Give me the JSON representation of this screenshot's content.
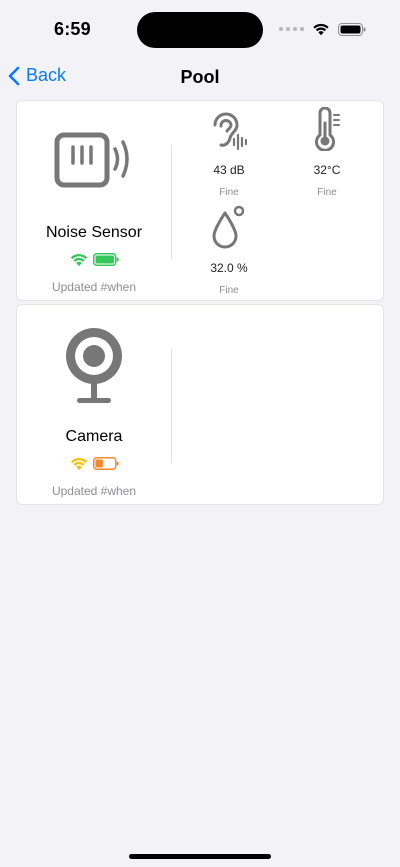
{
  "status_bar": {
    "time": "6:59"
  },
  "nav": {
    "back_label": "Back",
    "title": "Pool"
  },
  "devices": [
    {
      "name": "Noise Sensor",
      "icon": "noise-sensor-icon",
      "wifi_color": "#34c759",
      "battery_color": "#34c759",
      "battery_level": 1.0,
      "updated": "Updated #when",
      "metrics": [
        {
          "icon": "ear-sound-icon",
          "value": "43 dB",
          "status": "Fine"
        },
        {
          "icon": "thermometer-icon",
          "value": "32°C",
          "status": "Fine"
        },
        {
          "icon": "humidity-drop-icon",
          "value": "32.0 %",
          "status": "Fine"
        }
      ]
    },
    {
      "name": "Camera",
      "icon": "webcam-icon",
      "wifi_color": "#f5c211",
      "battery_color": "#f2892a",
      "battery_level": 0.4,
      "updated": "Updated #when",
      "metrics": []
    }
  ]
}
